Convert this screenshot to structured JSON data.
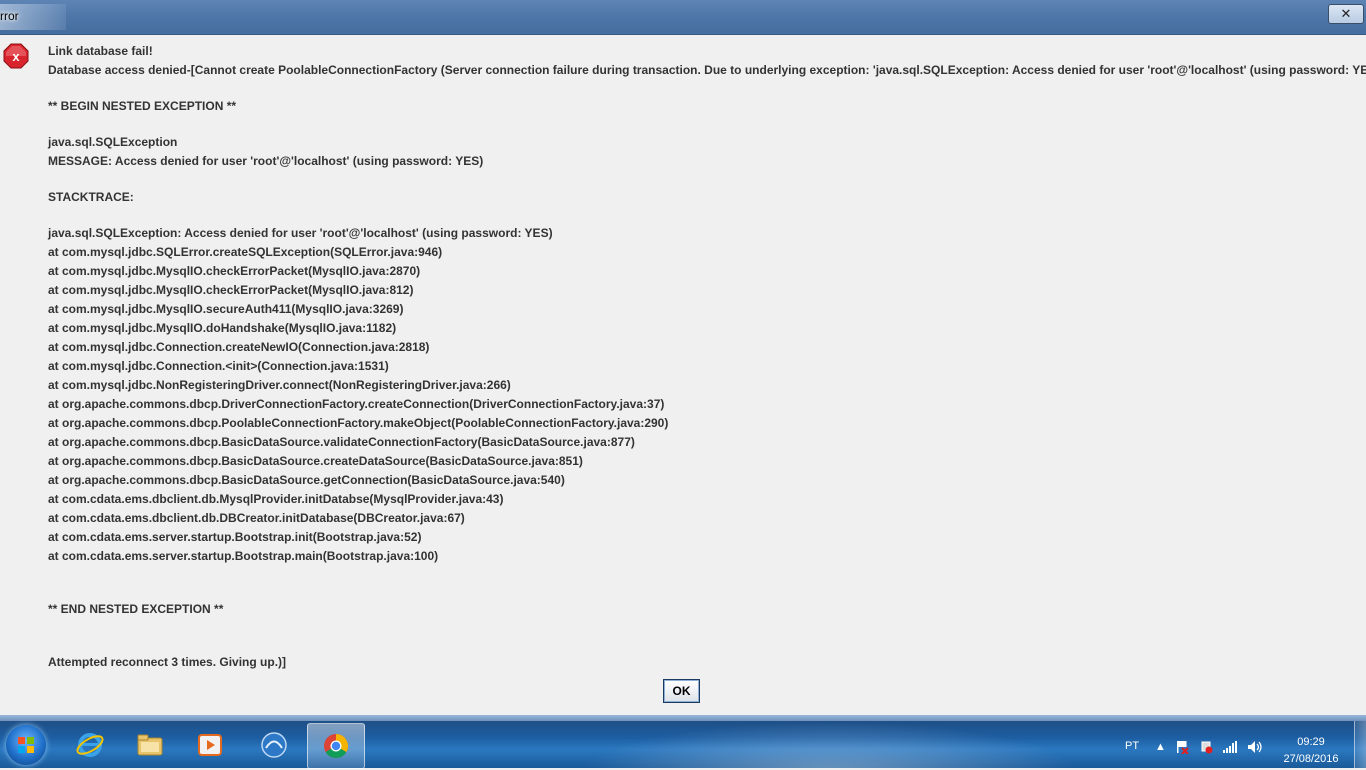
{
  "window": {
    "title": "rror",
    "close_label": "✕"
  },
  "dialog": {
    "lines": [
      "Link database fail!",
      "Database access denied-[Cannot create PoolableConnectionFactory (Server connection failure during transaction. Due to underlying exception: 'java.sql.SQLException: Access denied for user 'root'@'localhost' (using password: YES)'.",
      "",
      "** BEGIN NESTED EXCEPTION **",
      "",
      "java.sql.SQLException",
      "MESSAGE: Access denied for user 'root'@'localhost' (using password: YES)",
      "",
      "STACKTRACE:",
      "",
      "java.sql.SQLException: Access denied for user 'root'@'localhost' (using password: YES)",
      "at com.mysql.jdbc.SQLError.createSQLException(SQLError.java:946)",
      "at com.mysql.jdbc.MysqlIO.checkErrorPacket(MysqlIO.java:2870)",
      "at com.mysql.jdbc.MysqlIO.checkErrorPacket(MysqlIO.java:812)",
      "at com.mysql.jdbc.MysqlIO.secureAuth411(MysqlIO.java:3269)",
      "at com.mysql.jdbc.MysqlIO.doHandshake(MysqlIO.java:1182)",
      "at com.mysql.jdbc.Connection.createNewIO(Connection.java:2818)",
      "at com.mysql.jdbc.Connection.<init>(Connection.java:1531)",
      "at com.mysql.jdbc.NonRegisteringDriver.connect(NonRegisteringDriver.java:266)",
      "at org.apache.commons.dbcp.DriverConnectionFactory.createConnection(DriverConnectionFactory.java:37)",
      "at org.apache.commons.dbcp.PoolableConnectionFactory.makeObject(PoolableConnectionFactory.java:290)",
      "at org.apache.commons.dbcp.BasicDataSource.validateConnectionFactory(BasicDataSource.java:877)",
      "at org.apache.commons.dbcp.BasicDataSource.createDataSource(BasicDataSource.java:851)",
      "at org.apache.commons.dbcp.BasicDataSource.getConnection(BasicDataSource.java:540)",
      "at com.cdata.ems.dbclient.db.MysqlProvider.initDatabse(MysqlProvider.java:43)",
      "at com.cdata.ems.dbclient.db.DBCreator.initDatabase(DBCreator.java:67)",
      "at com.cdata.ems.server.startup.Bootstrap.init(Bootstrap.java:52)",
      "at com.cdata.ems.server.startup.Bootstrap.main(Bootstrap.java:100)",
      "",
      "",
      "** END NESTED EXCEPTION **",
      "",
      "",
      "Attempted reconnect 3 times. Giving up.)]"
    ],
    "ok_label": "OK",
    "icon": "error-icon",
    "icon_color": "#d9232d"
  },
  "taskbar": {
    "apps": [
      {
        "name": "internet-explorer-icon"
      },
      {
        "name": "file-explorer-icon"
      },
      {
        "name": "media-player-icon"
      },
      {
        "name": "blue-circle-app-icon"
      },
      {
        "name": "chrome-icon",
        "active": true
      }
    ],
    "language": "PT",
    "time": "09:29",
    "date": "27/08/2016"
  }
}
